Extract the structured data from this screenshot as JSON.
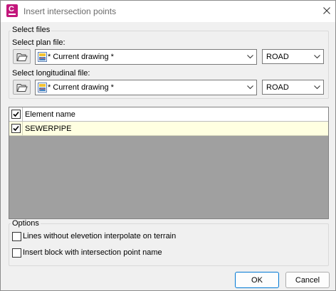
{
  "window": {
    "title": "Insert intersection points"
  },
  "select_files": {
    "group_label": "Select files",
    "plan_label": "Select plan file:",
    "plan_value": "* Current drawing *",
    "plan_type": "ROAD",
    "long_label": "Select longitudinal file:",
    "long_value": "* Current drawing *",
    "long_type": "ROAD"
  },
  "grid": {
    "header": {
      "checked": true,
      "column": "Element name"
    },
    "rows": [
      {
        "checked": true,
        "name": "SEWERPIPE"
      }
    ]
  },
  "options": {
    "group_label": "Options",
    "opt1_label": "Lines without elevetion interpolate on terrain",
    "opt1_checked": false,
    "opt2_label": "Insert block with intersection point name",
    "opt2_checked": false
  },
  "buttons": {
    "ok": "OK",
    "cancel": "Cancel"
  },
  "icons": {
    "app": "civil-app-icon",
    "close": "close-icon",
    "folder": "folder-open-icon",
    "file": "drawing-file-icon",
    "dropdown": "chevron-down-icon"
  },
  "colors": {
    "app_icon": "#c3177c",
    "selected_row": "#ffffe1",
    "grid_background": "#a0a0a0",
    "primary_border": "#0078d4"
  }
}
